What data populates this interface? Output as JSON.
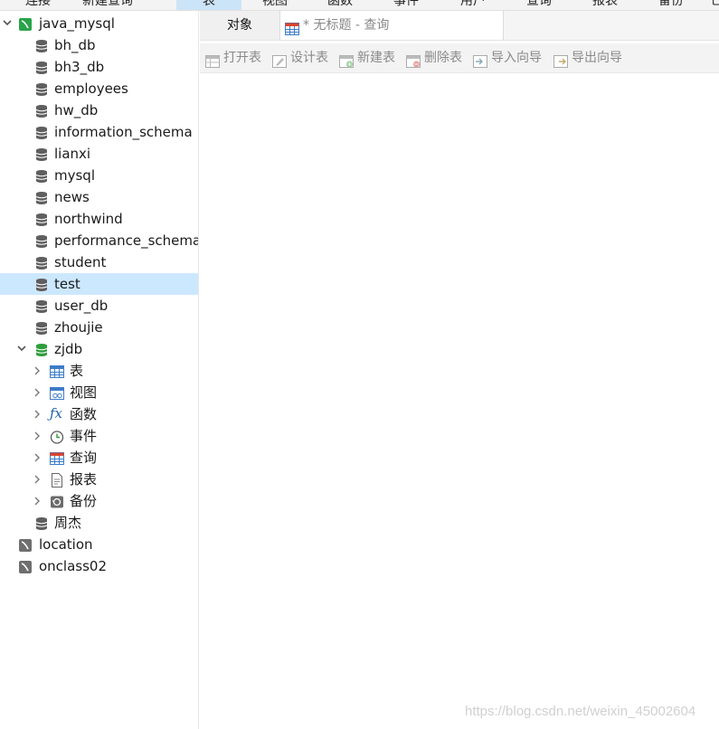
{
  "menu": [
    {
      "label": "连接"
    },
    {
      "label": "新建查询"
    },
    {
      "label": "表"
    },
    {
      "label": "视图"
    },
    {
      "label": "函数"
    },
    {
      "label": "事件"
    },
    {
      "label": "用户"
    },
    {
      "label": "查询"
    },
    {
      "label": "报表"
    },
    {
      "label": "备份"
    },
    {
      "label": "已"
    }
  ],
  "tree": {
    "connection": "java_mysql",
    "databases": [
      "bh_db",
      "bh3_db",
      "employees",
      "hw_db",
      "information_schema",
      "lianxi",
      "mysql",
      "news",
      "northwind",
      "performance_schema",
      "student",
      "test",
      "user_db",
      "zhoujie"
    ],
    "selected": "test",
    "open_db": "zjdb",
    "open_db_children": [
      "表",
      "视图",
      "函数",
      "事件",
      "查询",
      "报表",
      "备份"
    ],
    "after_db": "周杰",
    "other_connections": [
      "location",
      "onclass02"
    ]
  },
  "tabs": {
    "objects": "对象",
    "query": "* 无标题 - 查询"
  },
  "toolbar": [
    "打开表",
    "设计表",
    "新建表",
    "删除表",
    "导入向导",
    "导出向导"
  ],
  "watermark": "https://blog.csdn.net/weixin_45002604",
  "colors": {
    "selected_bg": "#cce8ff",
    "db_icon": "#5f5f5f",
    "open_db_icon": "#2e9e3a",
    "connection_icon": "#2aa34a",
    "disabled_text": "#8a8a8a"
  }
}
